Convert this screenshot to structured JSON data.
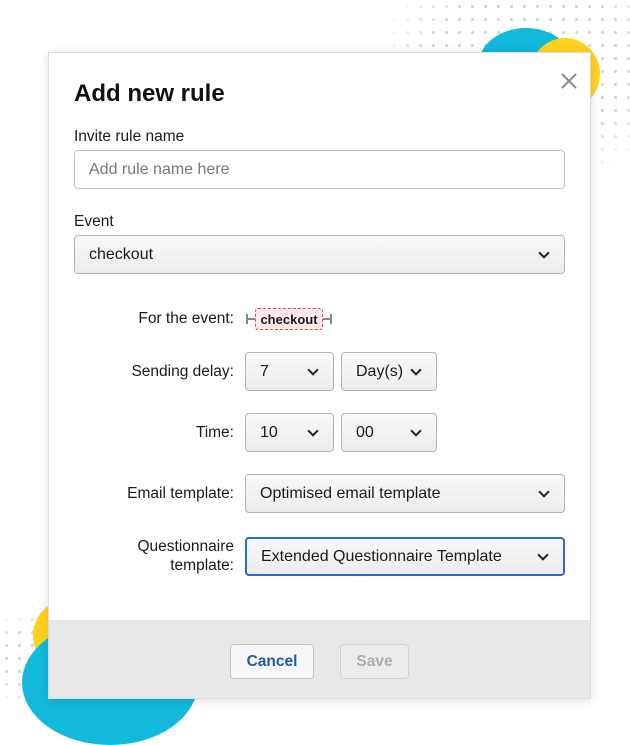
{
  "dialog": {
    "title": "Add new rule",
    "rule_name": {
      "label": "Invite rule name",
      "placeholder": "Add rule name here"
    },
    "event": {
      "label": "Event",
      "value": "checkout"
    },
    "for_event": {
      "label": "For the event:",
      "tag": "checkout"
    },
    "sending_delay": {
      "label": "Sending delay:",
      "amount": "7",
      "unit": "Day(s)"
    },
    "time": {
      "label": "Time:",
      "hour": "10",
      "minute": "00"
    },
    "email_template": {
      "label": "Email template:",
      "value": "Optimised email template"
    },
    "questionnaire_template": {
      "label_line1": "Questionnaire",
      "label_line2": "template:",
      "value": "Extended Questionnaire Template"
    },
    "buttons": {
      "cancel": "Cancel",
      "save": "Save"
    }
  },
  "icons": {
    "close": "close-icon",
    "dropdown": "chevron-down-icon"
  },
  "colors": {
    "accent": "#2a6bd8",
    "link": "#1f5aa8",
    "tag_border": "#e2474a",
    "tag_bg": "#fde9e9",
    "teal": "#12b9db",
    "yellow": "#ffd21f"
  }
}
